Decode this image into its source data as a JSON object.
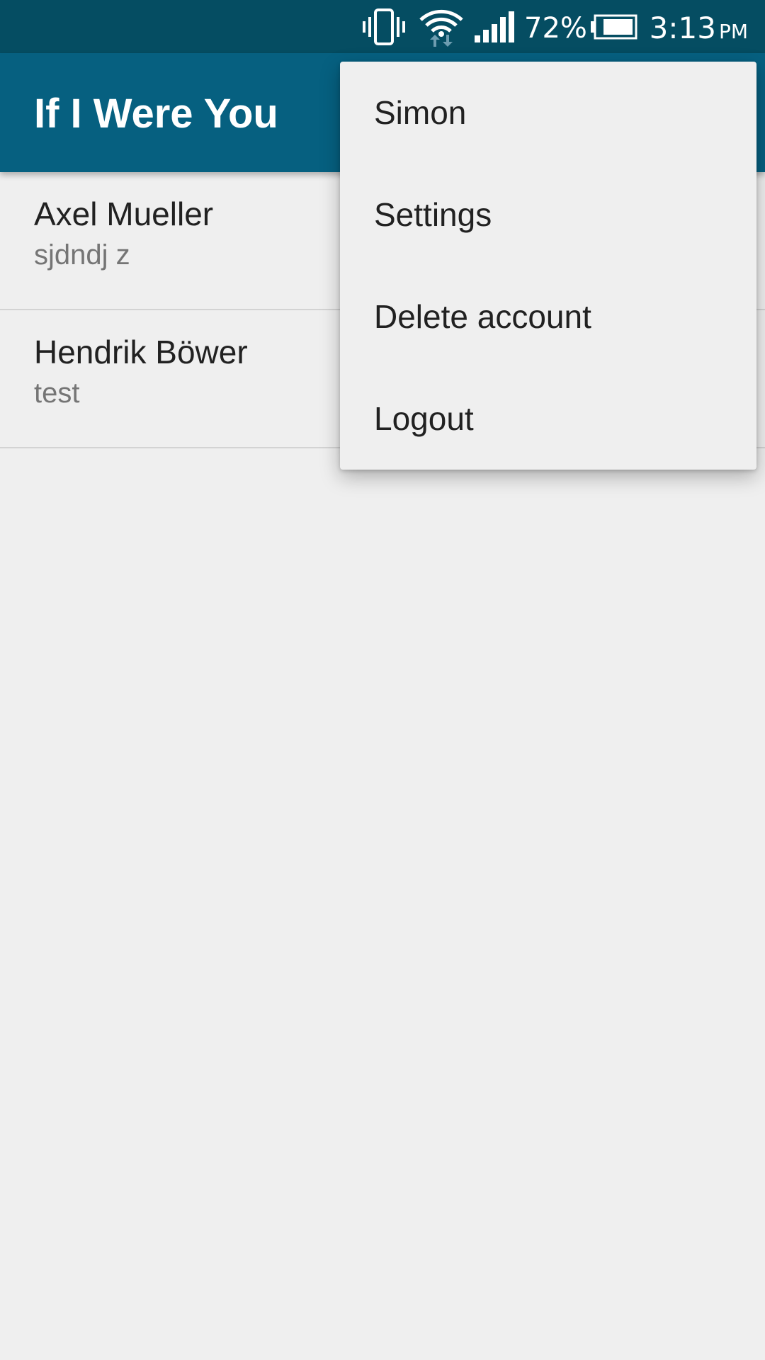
{
  "status_bar": {
    "icons": [
      "vibrate-icon",
      "wifi-icon",
      "signal-icon",
      "battery-icon"
    ],
    "battery_percent": "72%",
    "time": "3:13",
    "ampm": "PM"
  },
  "app_bar": {
    "title": "If I Were You"
  },
  "conversations": [
    {
      "name": "Axel Mueller",
      "preview": "sjdndj z"
    },
    {
      "name": "Hendrik Böwer",
      "preview": "test"
    }
  ],
  "menu": {
    "items": [
      {
        "label": "Simon"
      },
      {
        "label": "Settings"
      },
      {
        "label": "Delete account"
      },
      {
        "label": "Logout"
      }
    ]
  },
  "colors": {
    "status_bar": "#054d62",
    "app_bar": "#066080",
    "background": "#efefef",
    "menu_background": "#efefef",
    "primary_text": "#212121",
    "secondary_text": "#757575"
  }
}
